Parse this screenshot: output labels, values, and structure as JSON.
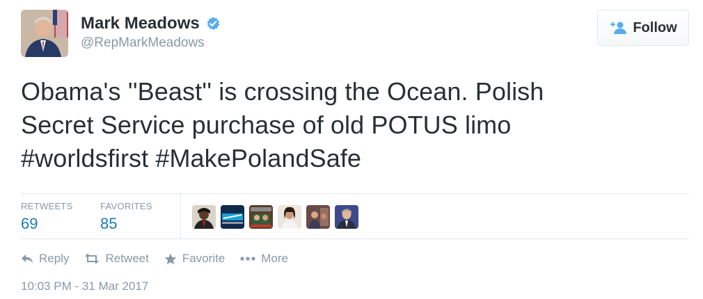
{
  "author": {
    "name": "Mark Meadows",
    "handle": "@RepMarkMeadows",
    "verified_icon": "verified-badge-icon",
    "avatar_icon": "avatar"
  },
  "follow": {
    "label": "Follow",
    "icon": "add-user-icon"
  },
  "tweet": {
    "lines": [
      "Obama's ''Beast'' is crossing the Ocean. Polish",
      "Secret Service purchase of old POTUS limo",
      "#worldsfirst #MakePolandSafe"
    ]
  },
  "stats": {
    "retweets_label": "RETWEETS",
    "retweets_value": "69",
    "favorites_label": "FAVORITES",
    "favorites_value": "85"
  },
  "actions": {
    "reply": "Reply",
    "retweet": "Retweet",
    "favorite": "Favorite",
    "more": "More"
  },
  "timestamp": "10:03 PM - 31 Mar 2017",
  "colors": {
    "text": "#292f33",
    "muted": "#8899a6",
    "link_blue": "#1b7bb8",
    "verified_blue": "#55acee",
    "divider": "#e1e8ed"
  }
}
